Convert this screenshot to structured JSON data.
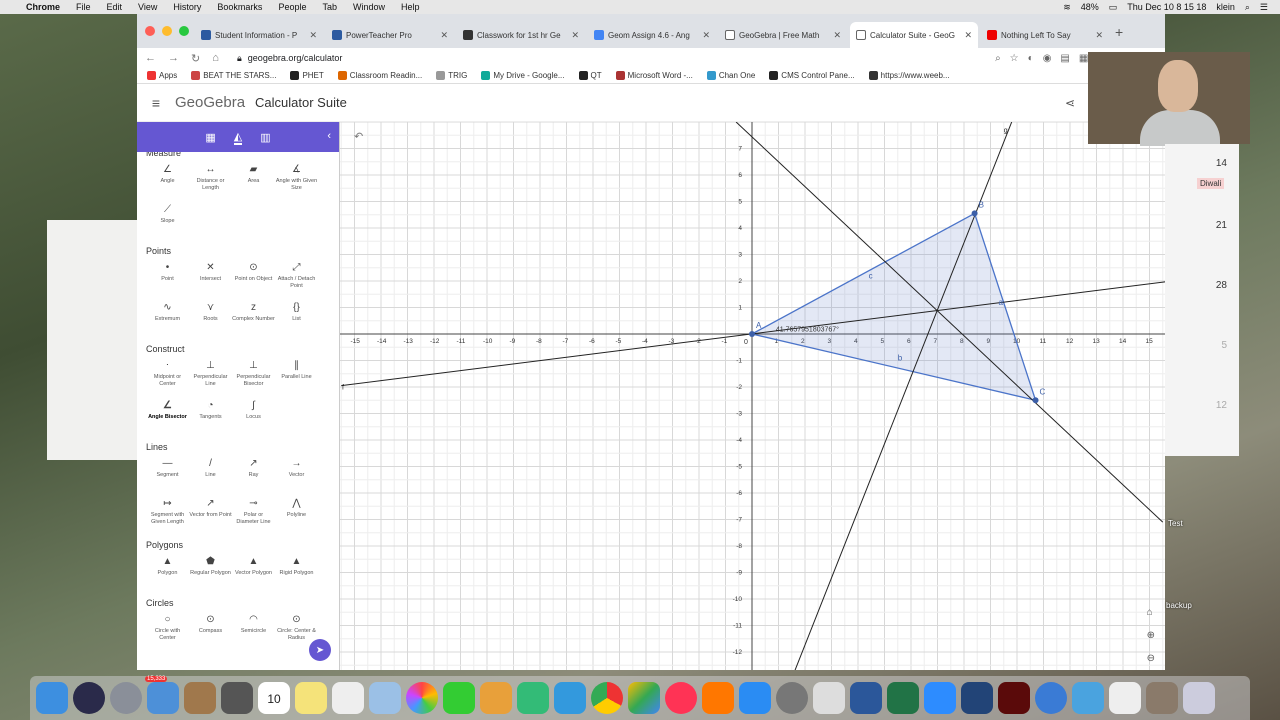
{
  "menubar": {
    "app": "Chrome",
    "items": [
      "File",
      "Edit",
      "View",
      "History",
      "Bookmarks",
      "People",
      "Tab",
      "Window",
      "Help"
    ],
    "battery": "48%",
    "clock": "Thu Dec 10  8 15 18",
    "user": "klein"
  },
  "tabs": [
    {
      "label": "Student Information - P",
      "color": "#2c5aa0"
    },
    {
      "label": "PowerTeacher Pro",
      "color": "#2c5aa0"
    },
    {
      "label": "Classwork for 1st hr Ge",
      "color": "#333"
    },
    {
      "label": "Geom Assign 4.6 - Ang",
      "color": "#4285f4"
    },
    {
      "label": "GeoGebra | Free Math",
      "color": "#666"
    },
    {
      "label": "Calculator Suite - GeoG",
      "color": "#666"
    },
    {
      "label": "Nothing Left To Say",
      "color": "#e00"
    }
  ],
  "address": {
    "url": "geogebra.org/calculator"
  },
  "bookmarks": [
    {
      "label": "Apps",
      "color": "#e33"
    },
    {
      "label": "BEAT THE STARS...",
      "color": "#c44"
    },
    {
      "label": "PHET",
      "color": "#222"
    },
    {
      "label": "Classroom Readin...",
      "color": "#d60"
    },
    {
      "label": "TRIG",
      "color": "#999"
    },
    {
      "label": "My Drive - Google...",
      "color": "#1a9"
    },
    {
      "label": "QT",
      "color": "#222"
    },
    {
      "label": "Microsoft Word -...",
      "color": "#a33"
    },
    {
      "label": "Chan One",
      "color": "#39c"
    },
    {
      "label": "CMS Control Pane...",
      "color": "#222"
    },
    {
      "label": "https://www.weeb...",
      "color": "#333"
    }
  ],
  "app": {
    "logo": "GeoGebra",
    "title": "Calculator Suite"
  },
  "sidebar": {
    "partial_section": "Measure",
    "sections": [
      {
        "title": "",
        "tools": [
          "Angle",
          "Distance or Length",
          "Area",
          "Angle with Given Size",
          "Slope"
        ]
      },
      {
        "title": "Points",
        "tools": [
          "Point",
          "Intersect",
          "Point on Object",
          "Attach / Detach Point",
          "Extremum",
          "Roots",
          "Complex Number",
          "List"
        ]
      },
      {
        "title": "Construct",
        "tools": [
          "Midpoint or Center",
          "Perpendicular Line",
          "Perpendicular Bisector",
          "Parallel Line",
          "Angle Bisector",
          "Tangents",
          "Locus"
        ]
      },
      {
        "title": "Lines",
        "tools": [
          "Segment",
          "Line",
          "Ray",
          "Vector",
          "Segment with Given Length",
          "Vector from Point",
          "Polar or Diameter Line",
          "Polyline"
        ]
      },
      {
        "title": "Polygons",
        "tools": [
          "Polygon",
          "Regular Polygon",
          "Vector Polygon",
          "Rigid Polygon"
        ]
      },
      {
        "title": "Circles",
        "tools": [
          "Circle with Center",
          "Compass",
          "Semicircle",
          "Circle: Center & Radius"
        ]
      }
    ],
    "selected_tool": "Angle Bisector"
  },
  "graph": {
    "points": {
      "A": "A",
      "B": "B",
      "C": "C"
    },
    "sides": {
      "a": "a",
      "b": "b",
      "c": "c"
    },
    "line_labels": {
      "f": "f",
      "g": "g"
    },
    "angle_label": "41.7657951803767°",
    "x_ticks": [
      "-15",
      "-14",
      "-13",
      "-12",
      "-11",
      "-10",
      "-9",
      "-8",
      "-7",
      "-6",
      "-5",
      "-4",
      "-3",
      "-2",
      "-1",
      "0",
      "1",
      "2",
      "3",
      "4",
      "5",
      "6",
      "7",
      "8",
      "9",
      "10",
      "11",
      "12",
      "13",
      "14",
      "15"
    ],
    "y_ticks": [
      "7",
      "6",
      "5",
      "4",
      "3",
      "2",
      "1",
      "-1",
      "-2",
      "-3",
      "-4",
      "-5",
      "-6",
      "-7",
      "-8",
      "-9",
      "-10",
      "-11",
      "-12"
    ]
  },
  "side_window": {
    "numbers": [
      "14",
      "21",
      "28",
      "5",
      "12"
    ],
    "labels": [
      "Diwali"
    ]
  },
  "desktop": {
    "labels": [
      "Test",
      "backup"
    ]
  },
  "dock": {
    "badge": "15,333",
    "calendar": "10"
  }
}
